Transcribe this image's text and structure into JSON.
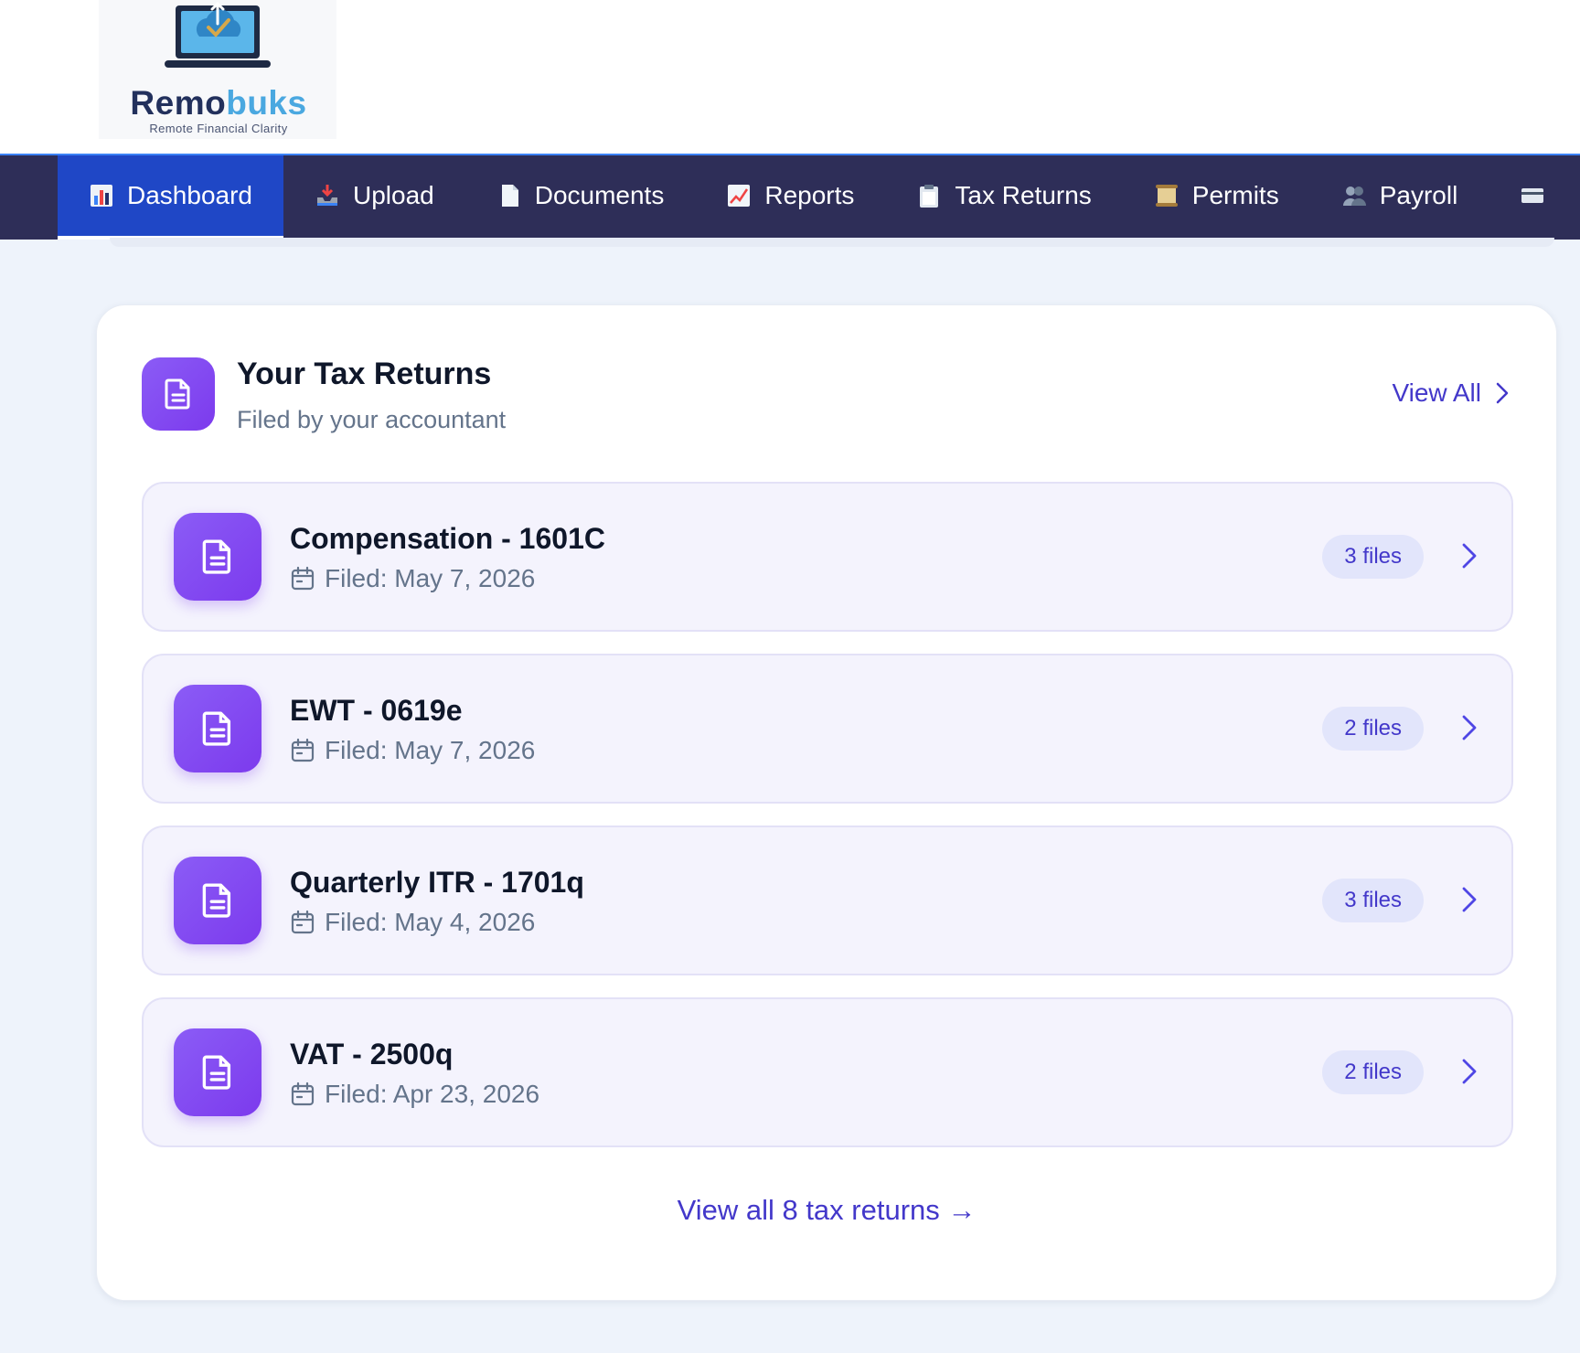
{
  "brand": {
    "name_part1": "Remo",
    "name_part2": "buks",
    "tagline": "Remote Financial Clarity"
  },
  "nav": {
    "items": [
      {
        "label": "Dashboard",
        "icon": "bar-chart-icon",
        "active": true
      },
      {
        "label": "Upload",
        "icon": "inbox-tray-icon",
        "active": false
      },
      {
        "label": "Documents",
        "icon": "page-icon",
        "active": false
      },
      {
        "label": "Reports",
        "icon": "chart-up-icon",
        "active": false
      },
      {
        "label": "Tax Returns",
        "icon": "clipboard-icon",
        "active": false
      },
      {
        "label": "Permits",
        "icon": "scroll-icon",
        "active": false
      },
      {
        "label": "Payroll",
        "icon": "people-icon",
        "active": false
      }
    ]
  },
  "tax_returns": {
    "title": "Your Tax Returns",
    "subtitle": "Filed by your accountant",
    "view_all_label": "View All",
    "items": [
      {
        "title": "Compensation - 1601C",
        "filed": "Filed: May 7, 2026",
        "files": "3 files"
      },
      {
        "title": "EWT - 0619e",
        "filed": "Filed: May 7, 2026",
        "files": "2 files"
      },
      {
        "title": "Quarterly ITR - 1701q",
        "filed": "Filed: May 4, 2026",
        "files": "3 files"
      },
      {
        "title": "VAT - 2500q",
        "filed": "Filed: Apr 23, 2026",
        "files": "2 files"
      }
    ],
    "footer_link": "View all 8 tax returns →"
  },
  "colors": {
    "nav_bg": "#2e2e58",
    "nav_active": "#1f47c6",
    "accent": "#4338ca",
    "icon_gradient_start": "#8b5cf6",
    "icon_gradient_end": "#7c3aed"
  }
}
